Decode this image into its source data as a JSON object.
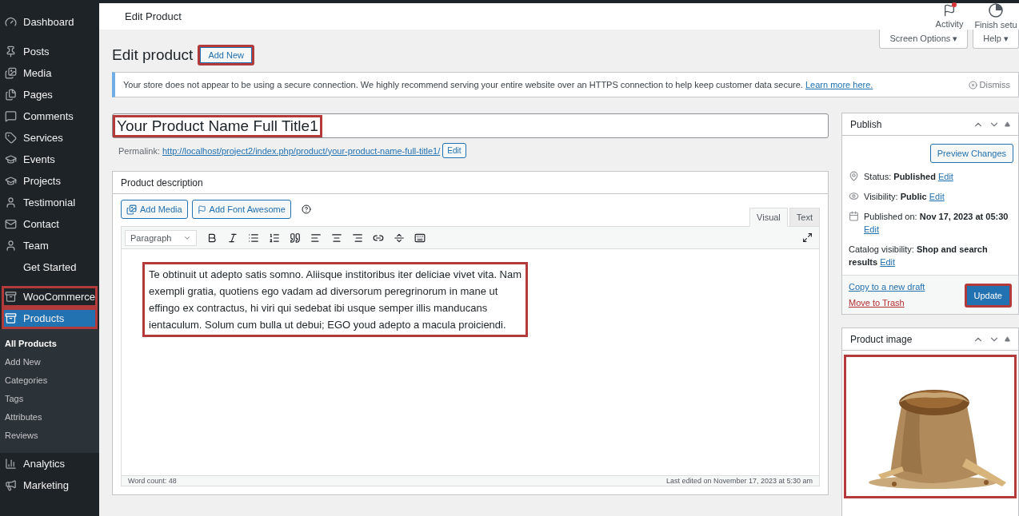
{
  "sidebar": {
    "groups": [
      {
        "items": [
          {
            "label": "Dashboard",
            "selected": false,
            "highlighted": false
          }
        ]
      },
      {
        "items": [
          {
            "label": "Posts",
            "selected": false,
            "highlighted": false
          },
          {
            "label": "Media",
            "selected": false,
            "highlighted": false
          },
          {
            "label": "Pages",
            "selected": false,
            "highlighted": false
          },
          {
            "label": "Comments",
            "selected": false,
            "highlighted": false
          },
          {
            "label": "Services",
            "selected": false,
            "highlighted": false
          },
          {
            "label": "Events",
            "selected": false,
            "highlighted": false
          },
          {
            "label": "Projects",
            "selected": false,
            "highlighted": false
          },
          {
            "label": "Testimonial",
            "selected": false,
            "highlighted": false
          },
          {
            "label": "Contact",
            "selected": false,
            "highlighted": false
          },
          {
            "label": "Team",
            "selected": false,
            "highlighted": false
          },
          {
            "label": "Get Started",
            "selected": false,
            "highlighted": false
          }
        ]
      },
      {
        "items": [
          {
            "label": "WooCommerce",
            "selected": false,
            "highlighted": true
          },
          {
            "label": "Products",
            "selected": true,
            "highlighted": true,
            "children": [
              {
                "label": "All Products",
                "selected": true
              },
              {
                "label": "Add New",
                "selected": false
              },
              {
                "label": "Categories",
                "selected": false
              },
              {
                "label": "Tags",
                "selected": false
              },
              {
                "label": "Attributes",
                "selected": false
              },
              {
                "label": "Reviews",
                "selected": false
              }
            ]
          },
          {
            "label": "Analytics",
            "selected": false,
            "highlighted": false
          },
          {
            "label": "Marketing",
            "selected": false,
            "highlighted": false
          }
        ]
      }
    ]
  },
  "header": {
    "title": "Edit Product",
    "actions": [
      {
        "label": "Activity",
        "notification": true
      },
      {
        "label": "Finish setu",
        "notification": false
      }
    ]
  },
  "screen_tabs": [
    {
      "label": "Screen Options ▾"
    },
    {
      "label": "Help ▾"
    }
  ],
  "page_title": "Edit product",
  "add_new": {
    "label": "Add New",
    "highlighted": true
  },
  "notice": {
    "text": "Your store does not appear to be using a secure connection. We highly recommend serving your entire website over an HTTPS connection to help keep customer data secure.",
    "link": "Learn more here.",
    "dismiss": "Dismiss"
  },
  "title_field": {
    "value": "Your Product Name Full Title1",
    "highlighted": true
  },
  "permalink": {
    "label": "Permalink:",
    "url": "http://localhost/project2/index.php/product/your-product-name-full-title1/",
    "button": "Edit"
  },
  "description": {
    "title": "Product description",
    "media_buttons": [
      "Add Media",
      "Add Font Awesome"
    ],
    "tabs": [
      {
        "label": "Visual",
        "selected": true
      },
      {
        "label": "Text",
        "selected": false
      }
    ],
    "format": "Paragraph",
    "content": {
      "text": "Te obtinuit ut adepto satis somno. Aliisque institoribus iter deliciae vivet vita. Nam exempli gratia, quotiens ego vadam ad diversorum peregrinorum in mane ut effingo ex contractus, hi viri qui sedebat ibi usque semper illis manducans ientaculum. Solum cum bulla ut debui; EGO youd adepto a macula proiciendi.",
      "highlighted": true
    },
    "word_count": "Word count: 48",
    "last_edited": "Last edited on November 17, 2023 at 5:30 am"
  },
  "publish": {
    "title": "Publish",
    "preview": "Preview Changes",
    "rows": [
      {
        "text": "Status: **Published**",
        "edit": "Edit"
      },
      {
        "text": "Visibility: **Public**",
        "edit": "Edit"
      },
      {
        "text": "Published on: **Nov 17, 2023 at 05:30**",
        "edit": "Edit"
      },
      {
        "text": "Catalog visibility: **Shop and search results**",
        "edit": "Edit"
      }
    ],
    "copy": "Copy to a new draft",
    "trash": "Move to Trash",
    "update": {
      "label": "Update",
      "highlighted": true
    }
  },
  "product_image": {
    "title": "Product image",
    "highlighted": true
  }
}
